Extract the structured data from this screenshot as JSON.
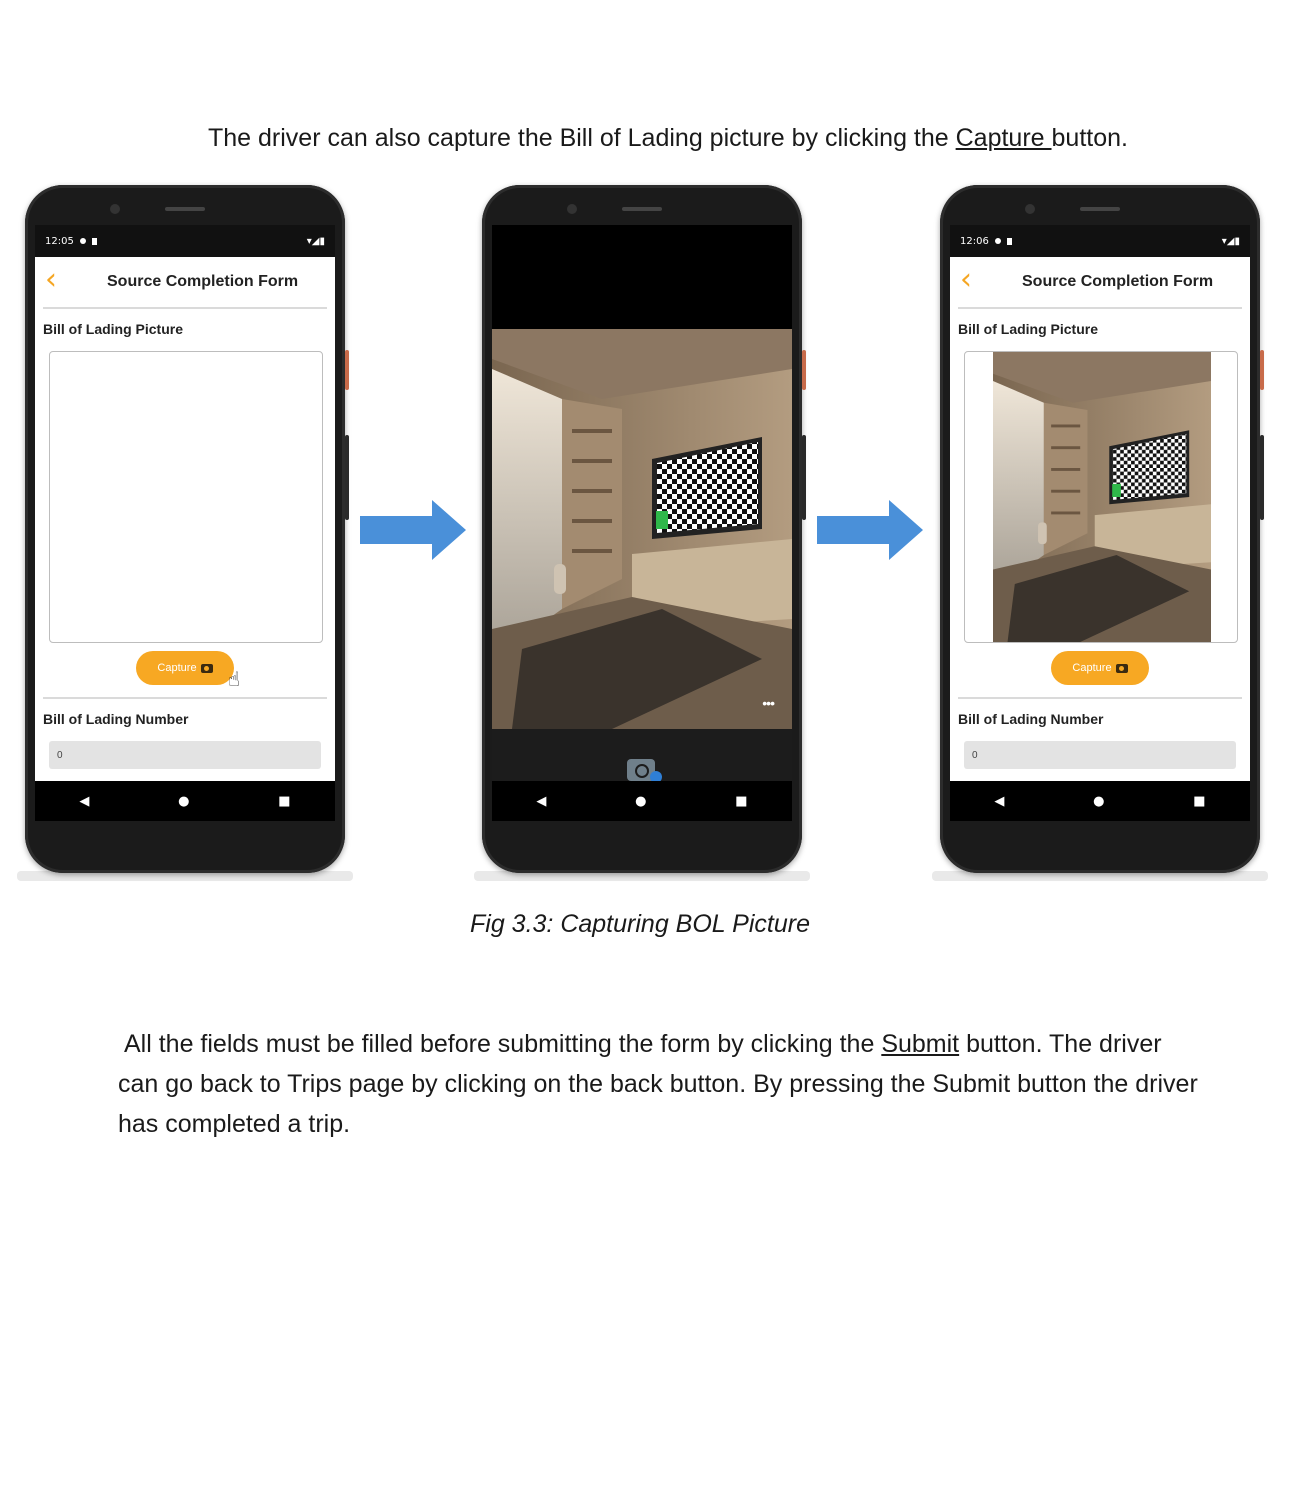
{
  "doc": {
    "intro_text_1": "The driver can also capture the Bill of Lading picture by clicking the ",
    "intro_link": "Capture ",
    "intro_text_2": "button.",
    "caption": "Fig 3.3: Capturing BOL Picture",
    "p1_text_1": "All the fields must be filled before submitting the form by clicking the ",
    "p1_link": "Submit",
    "p1_text_2": " button. The driver",
    "p2": "can go back to Trips page by clicking on the back button. By pressing the Submit button the driver",
    "p3": "has completed a trip."
  },
  "phone1": {
    "time": "12:05",
    "title": "Source Completion Form",
    "pic_label": "Bill of Lading Picture",
    "capture_label": "Capture",
    "number_label": "Bill of Lading Number",
    "number_value": "0"
  },
  "phone2": {
    "more_label": "•••"
  },
  "phone3": {
    "time": "12:06",
    "title": "Source Completion Form",
    "pic_label": "Bill of Lading Picture",
    "capture_label": "Capture",
    "number_label": "Bill of Lading Number",
    "number_value": "0"
  },
  "icons": {
    "back": "chevron-left-icon",
    "camera": "camera-icon",
    "hand_cursor": "hand-pointer-icon",
    "arrow": "arrow-right-icon"
  },
  "colors": {
    "accent": "#f7a823",
    "arrow": "#4a90d9",
    "phone_body": "#1b1b1b"
  }
}
